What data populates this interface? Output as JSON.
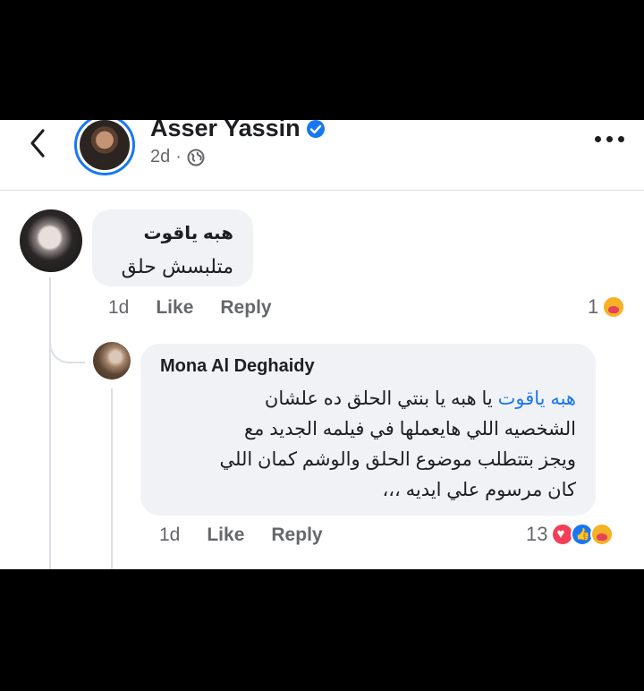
{
  "post": {
    "author": "Asser Yassin",
    "time": "2d",
    "separator": "·"
  },
  "comments": [
    {
      "author": "هبه ياقوت",
      "text": "متلبسش حلق",
      "time": "1d",
      "like_label": "Like",
      "reply_label": "Reply",
      "reaction_count": "1",
      "reactions": [
        "care"
      ]
    }
  ],
  "reply": {
    "author": "Mona Al Deghaidy",
    "mention": "هبه ياقوت",
    "line1_rest": " يا هبه يا بنتي الحلق ده علشان",
    "line2": "الشخصيه اللي هايعملها في فيلمه الجديد مع",
    "line3": "ويجز بتتطلب موضوع الحلق والوشم كمان اللي",
    "line4": "كان مرسوم علي ايديه ،،،",
    "time": "1d",
    "like_label": "Like",
    "reply_label": "Reply",
    "reaction_count": "13",
    "reactions": [
      "love",
      "like",
      "care"
    ]
  },
  "colors": {
    "accent": "#1877f2",
    "bubble": "#f0f2f5",
    "secondary_text": "#65676b"
  }
}
